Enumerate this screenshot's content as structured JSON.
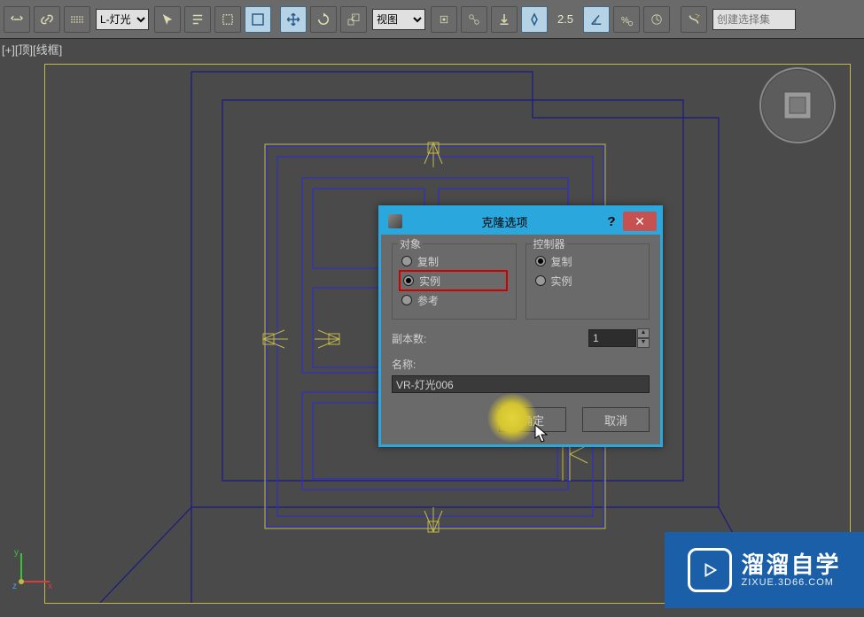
{
  "toolbar": {
    "layer_select": "L-灯光",
    "view_select": "视图",
    "spinner_value": "2.5",
    "selection_set_placeholder": "创建选择集"
  },
  "viewport": {
    "label": "[+][顶][线框]"
  },
  "dialog": {
    "title": "克隆选项",
    "object_group": "对象",
    "controller_group": "控制器",
    "radio_copy": "复制",
    "radio_instance": "实例",
    "radio_reference": "参考",
    "copies_label": "副本数:",
    "copies_value": "1",
    "name_label": "名称:",
    "name_value": "VR-灯光006",
    "ok": "确定",
    "cancel": "取消"
  },
  "watermark": {
    "main": "溜溜自学",
    "sub": "ZIXUE.3D66.COM"
  }
}
